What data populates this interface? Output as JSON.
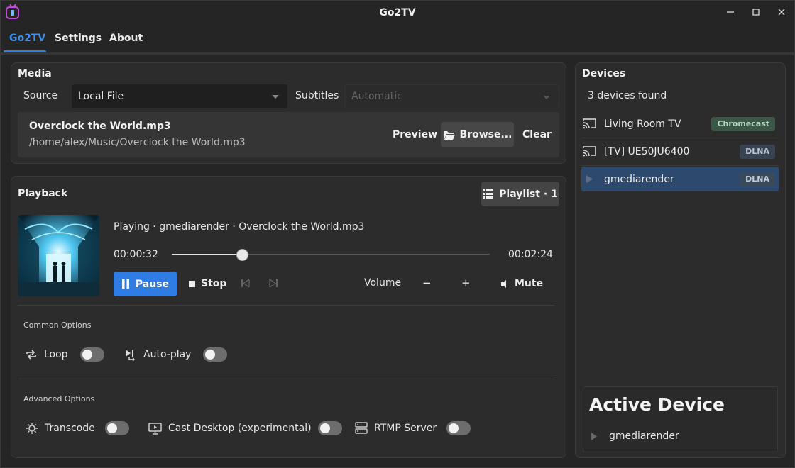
{
  "window": {
    "title": "Go2TV"
  },
  "tabs": [
    {
      "label": "Go2TV",
      "active": true
    },
    {
      "label": "Settings",
      "active": false
    },
    {
      "label": "About",
      "active": false
    }
  ],
  "media": {
    "title": "Media",
    "source_label": "Source",
    "source_value": "Local File",
    "subtitles_label": "Subtitles",
    "subtitles_value": "Automatic",
    "file_name": "Overclock the World.mp3",
    "file_path": "/home/alex/Music/Overclock the World.mp3",
    "preview_label": "Preview",
    "browse_label": "Browse...",
    "clear_label": "Clear"
  },
  "playback": {
    "title": "Playback",
    "playlist_label": "Playlist · 1",
    "now_playing": "Playing · gmediarender · Overclock the World.mp3",
    "time_elapsed": "00:00:32",
    "time_total": "00:02:24",
    "progress_fraction": 0.222,
    "pause_label": "Pause",
    "stop_label": "Stop",
    "volume_label": "Volume",
    "vol_down": "−",
    "vol_up": "+",
    "mute_label": "Mute"
  },
  "common_options": {
    "title": "Common Options",
    "loop_label": "Loop",
    "loop_on": false,
    "autoplay_label": "Auto-play",
    "autoplay_on": false
  },
  "advanced_options": {
    "title": "Advanced Options",
    "transcode_label": "Transcode",
    "transcode_on": false,
    "cast_desktop_label": "Cast Desktop (experimental)",
    "cast_desktop_on": false,
    "rtmp_label": "RTMP Server",
    "rtmp_on": false
  },
  "devices": {
    "title": "Devices",
    "count_text": "3 devices found",
    "items": [
      {
        "name": "Living Room TV",
        "badge": "Chromecast",
        "icon": "cast-icon",
        "selected": false
      },
      {
        "name": "[TV] UE50JU6400",
        "badge": "DLNA",
        "icon": "cast-icon",
        "selected": false
      },
      {
        "name": "gmediarender",
        "badge": "DLNA",
        "icon": "play-arrow-icon",
        "selected": true
      }
    ],
    "active_title": "Active Device",
    "active_name": "gmediarender"
  },
  "colors": {
    "accent": "#2f7de4",
    "selected_row": "#2d4a6e",
    "chromecast_badge": "#3c5647",
    "dlna_badge": "#3a4352"
  }
}
